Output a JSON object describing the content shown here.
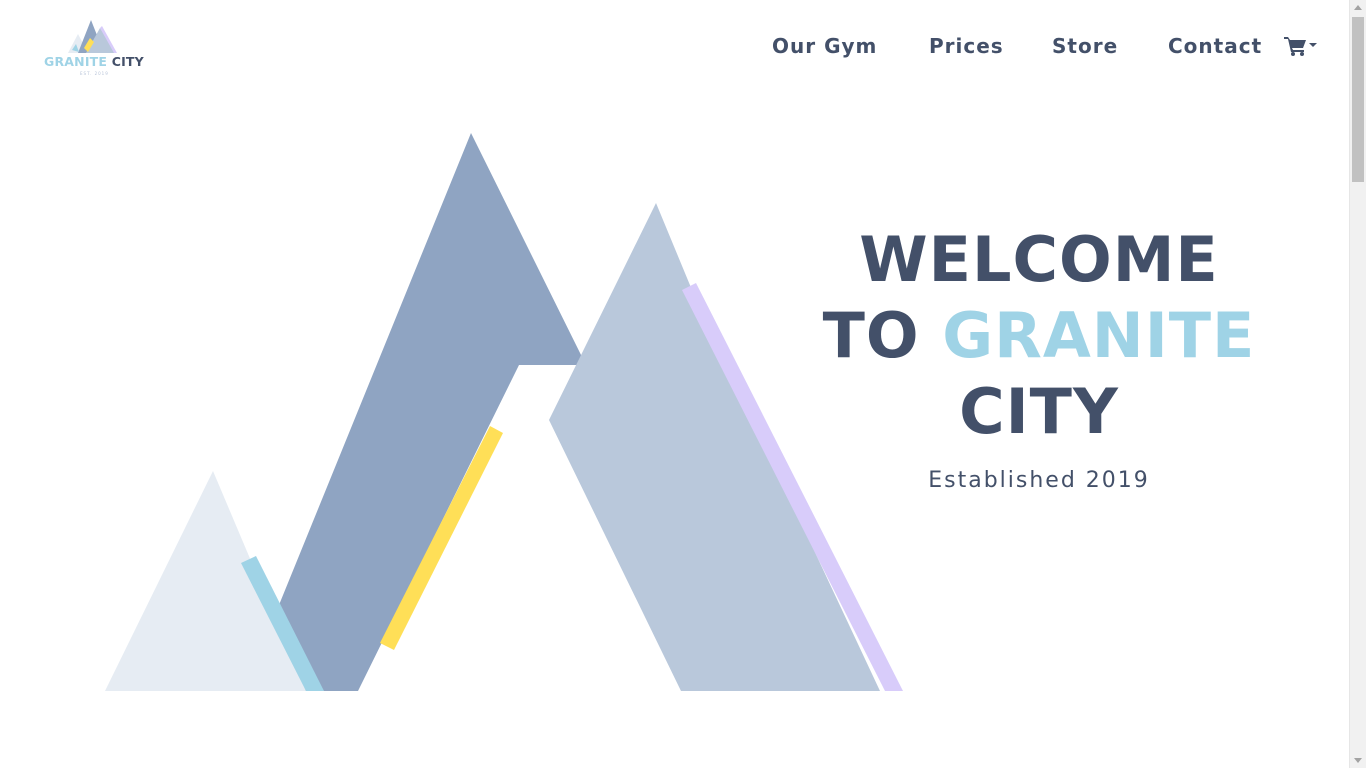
{
  "brand": {
    "name_part1": "GRANITE",
    "name_part2": "CITY",
    "est": "EST. 2019"
  },
  "nav": {
    "items": [
      {
        "label": "Our Gym"
      },
      {
        "label": "Prices"
      },
      {
        "label": "Store"
      },
      {
        "label": "Contact"
      }
    ],
    "cart_icon": "shopping-cart-icon",
    "dropdown_icon": "caret-down-icon"
  },
  "hero": {
    "line1": "WELCOME",
    "line2_part1": "TO",
    "line2_part2": "GRANITE",
    "line3": "CITY",
    "subtitle": "Established 2019"
  },
  "colors": {
    "navy": "#435069",
    "accent_blue": "#9fd3e6",
    "mountain_mid": "#8fa4c2",
    "mountain_light": "#b9c8db",
    "mountain_pale": "#e6ecf3",
    "stripe_yellow": "#ffdf57",
    "stripe_lavender": "#d8ccfa",
    "stripe_blue": "#9fd3e6"
  }
}
